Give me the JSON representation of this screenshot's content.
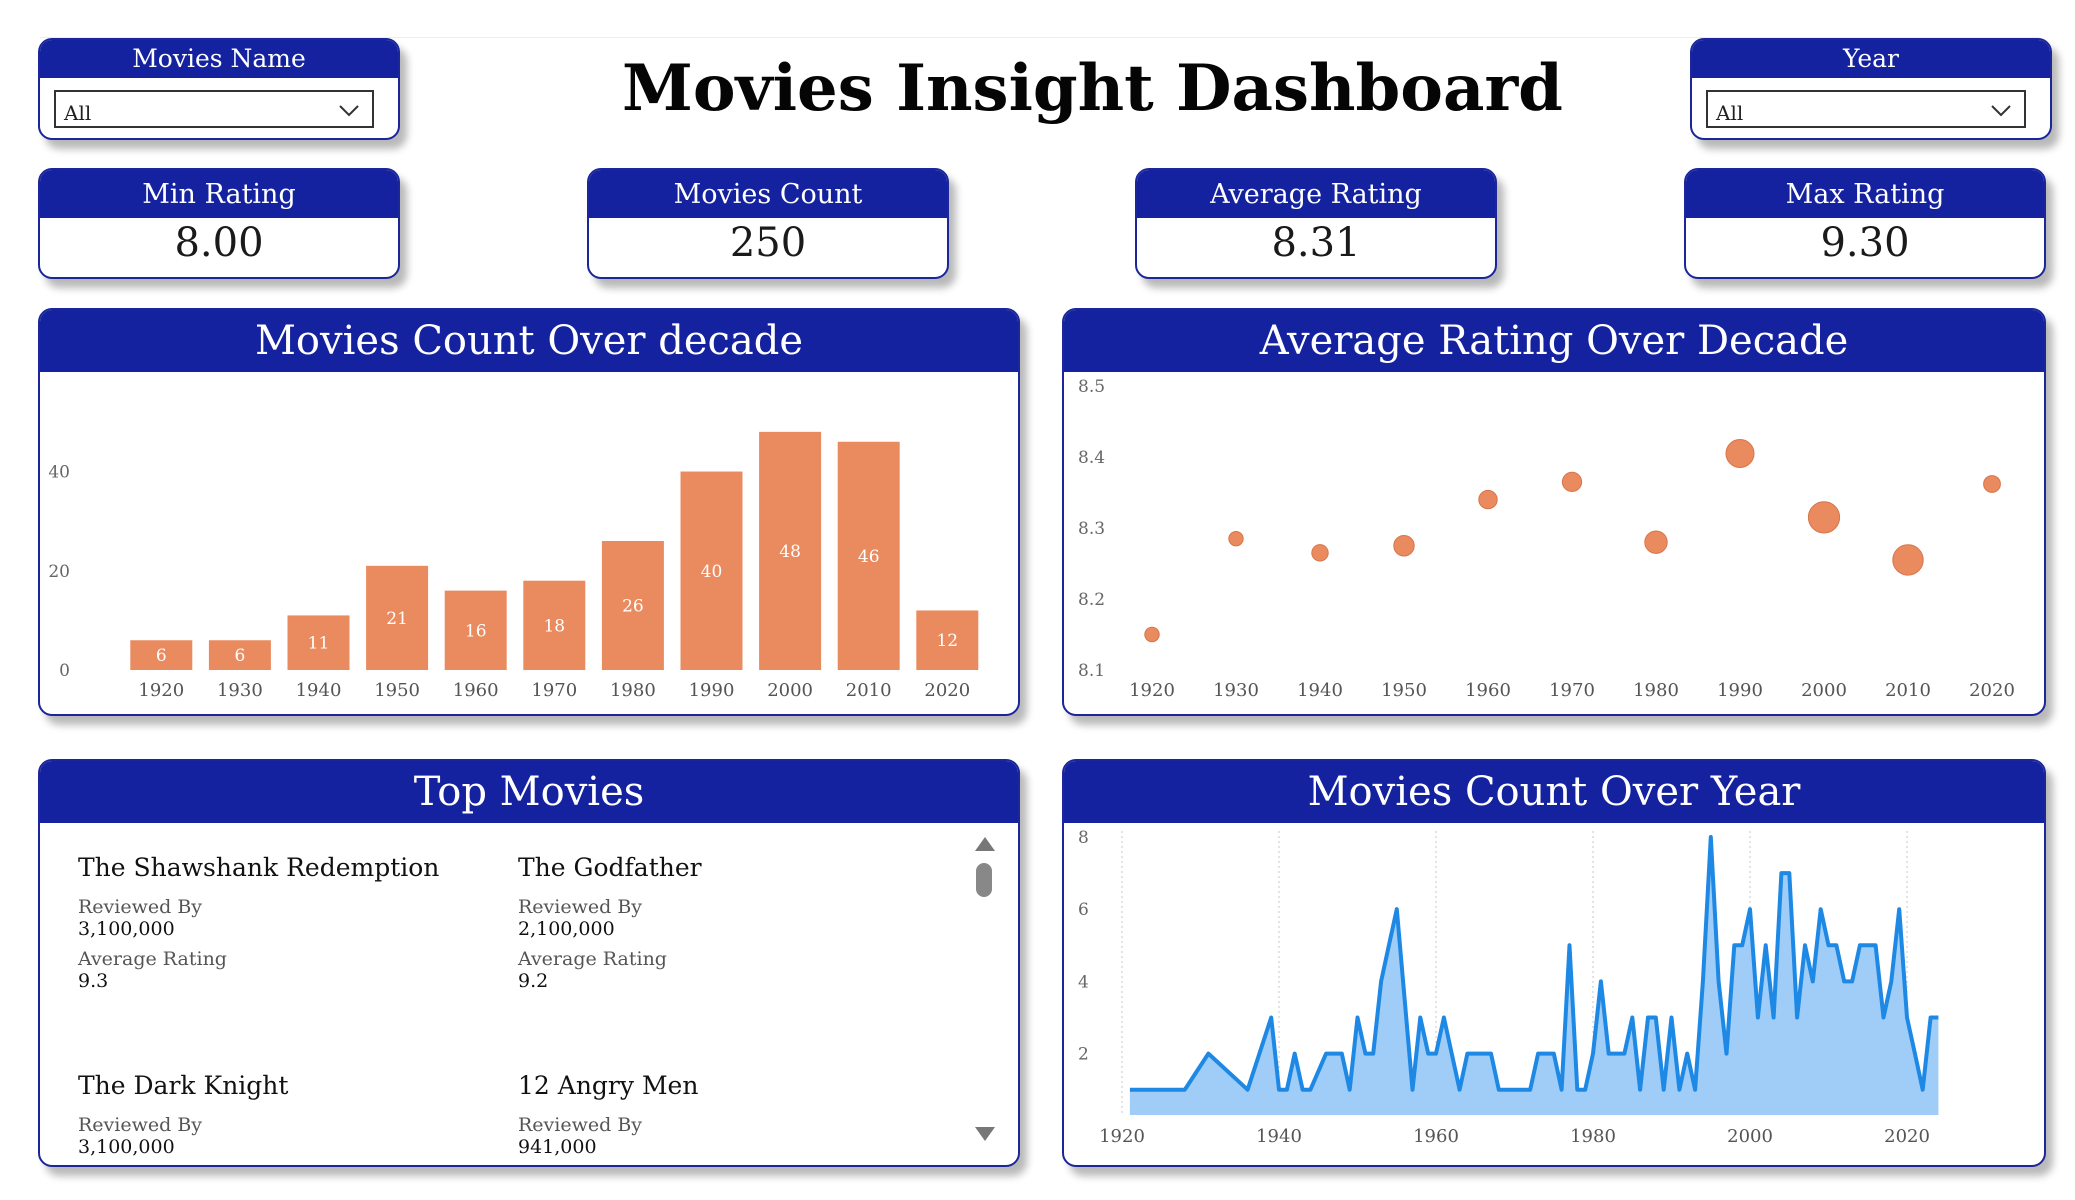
{
  "header": {
    "title": "Movies Insight Dashboard",
    "icon": "clapperboard-icon"
  },
  "slicers": {
    "movies_name": {
      "label": "Movies Name",
      "value": "All"
    },
    "year": {
      "label": "Year",
      "value": "All"
    }
  },
  "kpis": {
    "min_rating": {
      "label": "Min Rating",
      "value": "8.00"
    },
    "movies_count": {
      "label": "Movies Count",
      "value": "250"
    },
    "avg_rating": {
      "label": "Average Rating",
      "value": "8.31"
    },
    "max_rating": {
      "label": "Max Rating",
      "value": "9.30"
    }
  },
  "top_movies": {
    "title": "Top Movies",
    "reviewed_label": "Reviewed By",
    "rating_label": "Average Rating",
    "items": [
      {
        "title": "The Shawshank Redemption",
        "reviewed": "3,100,000",
        "rating": "9.3"
      },
      {
        "title": "The Godfather",
        "reviewed": "2,100,000",
        "rating": "9.2"
      },
      {
        "title": "The Dark Knight",
        "reviewed": "3,100,000"
      },
      {
        "title": "12 Angry Men",
        "reviewed": "941,000"
      }
    ]
  },
  "colors": {
    "brand": "#1522a0",
    "bar": "#e98b5f",
    "line": "#1e88e5",
    "area": "#9fcdf7"
  },
  "chart_data": [
    {
      "type": "bar",
      "title": "Movies Count Over decade",
      "categories": [
        "1920",
        "1930",
        "1940",
        "1950",
        "1960",
        "1970",
        "1980",
        "1990",
        "2000",
        "2010",
        "2020"
      ],
      "values": [
        6,
        6,
        11,
        21,
        16,
        18,
        26,
        40,
        48,
        46,
        12
      ],
      "yticks": [
        0,
        20,
        40
      ],
      "ylim": [
        0,
        52
      ]
    },
    {
      "type": "scatter",
      "title": "Average Rating Over Decade",
      "x": [
        "1920",
        "1930",
        "1940",
        "1950",
        "1960",
        "1970",
        "1980",
        "1990",
        "2000",
        "2010",
        "2020"
      ],
      "y": [
        8.15,
        8.285,
        8.265,
        8.275,
        8.34,
        8.365,
        8.28,
        8.405,
        8.315,
        8.255,
        8.362
      ],
      "size": [
        6,
        6,
        11,
        21,
        16,
        18,
        26,
        40,
        48,
        46,
        12
      ],
      "yticks": [
        "8.1",
        "8.2",
        "8.3",
        "8.4",
        "8.5"
      ],
      "ylim": [
        8.1,
        8.5
      ]
    },
    {
      "type": "area",
      "title": "Movies Count Over Year",
      "x": [
        1921,
        1924,
        1925,
        1926,
        1927,
        1928,
        1931,
        1936,
        1939,
        1940,
        1941,
        1942,
        1943,
        1944,
        1946,
        1948,
        1949,
        1950,
        1951,
        1952,
        1953,
        1954,
        1955,
        1957,
        1958,
        1959,
        1960,
        1961,
        1962,
        1963,
        1964,
        1965,
        1966,
        1967,
        1968,
        1971,
        1972,
        1973,
        1975,
        1976,
        1977,
        1978,
        1979,
        1980,
        1981,
        1982,
        1983,
        1984,
        1985,
        1986,
        1987,
        1988,
        1989,
        1990,
        1991,
        1992,
        1993,
        1994,
        1995,
        1996,
        1997,
        1998,
        1999,
        2000,
        2001,
        2002,
        2003,
        2004,
        2005,
        2006,
        2007,
        2008,
        2009,
        2010,
        2011,
        2012,
        2013,
        2014,
        2015,
        2016,
        2017,
        2018,
        2019,
        2020,
        2021,
        2022,
        2023,
        2024
      ],
      "y": [
        1,
        1,
        1,
        1,
        1,
        1,
        2,
        1,
        3,
        1,
        1,
        2,
        1,
        1,
        2,
        2,
        1,
        3,
        2,
        2,
        4,
        5,
        6,
        1,
        3,
        2,
        2,
        3,
        2,
        1,
        2,
        2,
        2,
        2,
        1,
        1,
        1,
        2,
        2,
        1,
        5,
        1,
        1,
        2,
        4,
        2,
        2,
        2,
        3,
        1,
        3,
        3,
        1,
        3,
        1,
        2,
        1,
        4,
        8,
        4,
        2,
        5,
        5,
        6,
        3,
        5,
        3,
        7,
        7,
        3,
        5,
        4,
        6,
        5,
        5,
        4,
        4,
        5,
        5,
        5,
        3,
        4,
        6,
        3,
        2,
        1,
        3,
        3
      ],
      "xticks": [
        "1920",
        "1940",
        "1960",
        "1980",
        "2000",
        "2020"
      ],
      "yticks": [
        "2",
        "4",
        "6",
        "8"
      ],
      "ylim": [
        0.3,
        8
      ],
      "xlim": [
        1920,
        2027
      ]
    }
  ]
}
